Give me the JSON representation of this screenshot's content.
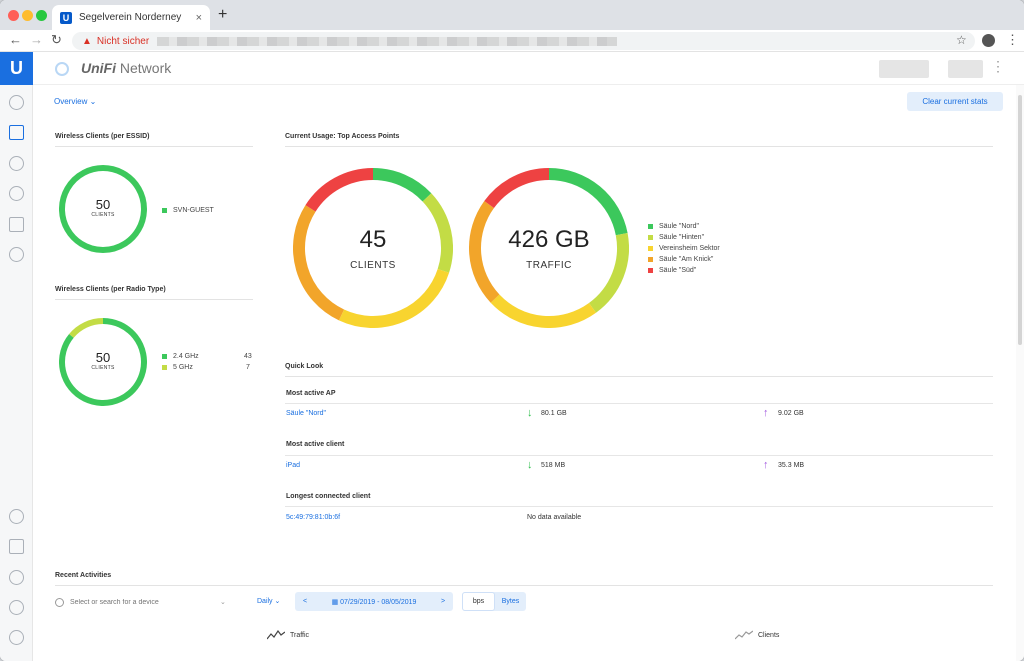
{
  "browser": {
    "tab_title": "Segelverein Norderney",
    "tab_close": "×",
    "new_tab": "+",
    "security_label": "Nicht sicher"
  },
  "app": {
    "brand_strong": "UniFi",
    "brand_rest": " Network",
    "view_label": "Overview",
    "clear_label": "Clear current stats"
  },
  "wireless_essid": {
    "title": "Wireless Clients (per ESSID)",
    "total": "50",
    "unit": "CLIENTS",
    "legend": [
      {
        "name": "SVN-GUEST",
        "color": "#3cc85c",
        "value": 50
      }
    ]
  },
  "wireless_radio": {
    "title": "Wireless Clients (per Radio Type)",
    "total": "50",
    "unit": "CLIENTS",
    "legend": [
      {
        "name": "2.4 GHz",
        "count": "43",
        "color": "#3cc85c",
        "value": 43
      },
      {
        "name": "5 GHz",
        "count": "7",
        "color": "#c3dc45",
        "value": 7
      }
    ]
  },
  "usage": {
    "title": "Current Usage: Top Access Points",
    "clients_total": "45",
    "clients_unit": "CLIENTS",
    "traffic_total": "426 GB",
    "traffic_unit": "TRAFFIC",
    "legend": [
      {
        "name": "Säule \"Nord\"",
        "color": "#3cc85c"
      },
      {
        "name": "Säule \"Hinten\"",
        "color": "#c3dc45"
      },
      {
        "name": "Vereinsheim Sektor",
        "color": "#f8d42f"
      },
      {
        "name": "Säule \"Am Knick\"",
        "color": "#f2a52a"
      },
      {
        "name": "Säule \"Süd\"",
        "color": "#ee4242"
      }
    ],
    "client_shares": [
      0.13,
      0.17,
      0.27,
      0.27,
      0.16
    ],
    "traffic_shares": [
      0.22,
      0.18,
      0.23,
      0.22,
      0.15
    ]
  },
  "quick_look": {
    "title": "Quick Look",
    "most_active_ap": {
      "label": "Most active AP",
      "name": "Säule \"Nord\"",
      "down": "80.1 GB",
      "up": "9.02 GB"
    },
    "most_active_client": {
      "label": "Most active client",
      "name": "iPad",
      "down": "518 MB",
      "up": "35.3 MB"
    },
    "longest_client": {
      "label": "Longest connected client",
      "name": "5c:49:79:81:0b:6f",
      "value": "No data available"
    }
  },
  "recent": {
    "title": "Recent Activities",
    "search_placeholder": "Select or search for a device",
    "interval": "Daily",
    "date_range": "07/29/2019 - 08/05/2019",
    "prev": "<",
    "next": ">",
    "unit_bps": "bps",
    "unit_bytes": "Bytes",
    "chart_traffic": "Traffic",
    "chart_clients": "Clients"
  }
}
